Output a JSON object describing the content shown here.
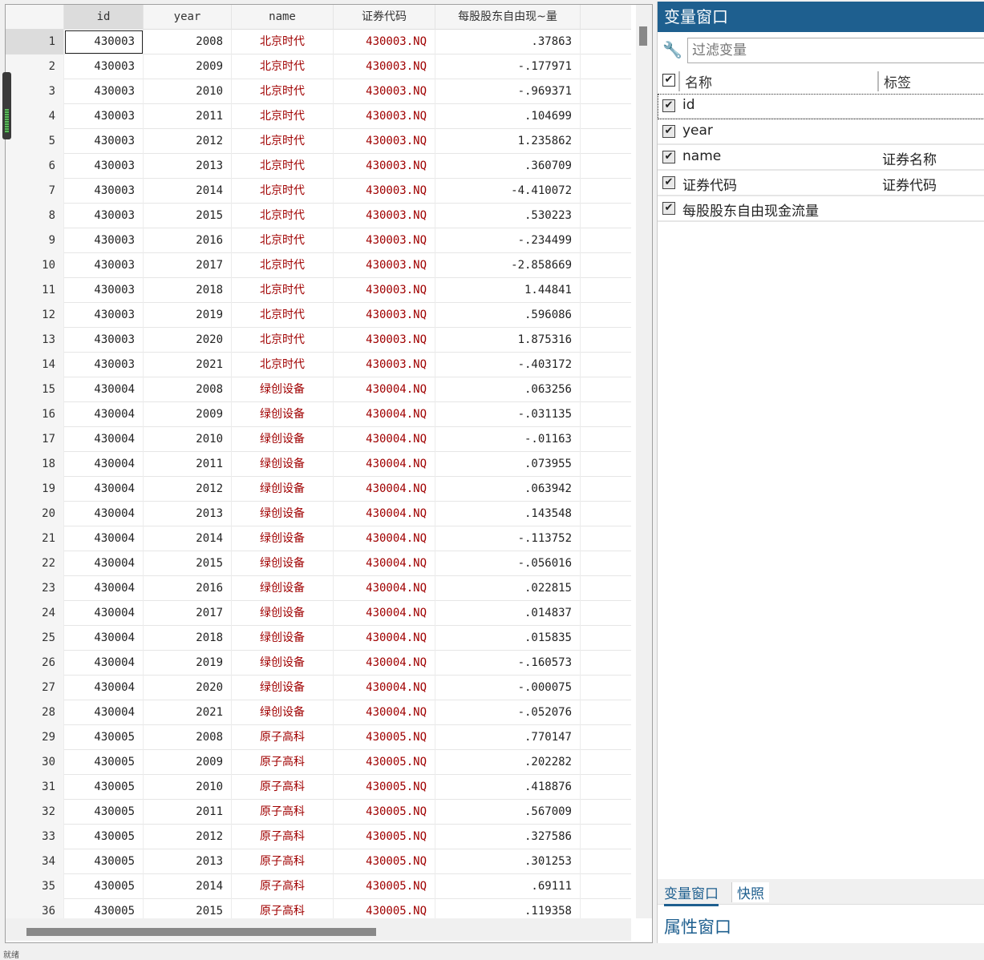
{
  "grid": {
    "headers": [
      "id",
      "year",
      "name",
      "证券代码",
      "每股股东自由现~量"
    ],
    "rows": [
      [
        "430003",
        "2008",
        "北京时代",
        "430003.NQ",
        ".37863"
      ],
      [
        "430003",
        "2009",
        "北京时代",
        "430003.NQ",
        "-.177971"
      ],
      [
        "430003",
        "2010",
        "北京时代",
        "430003.NQ",
        "-.969371"
      ],
      [
        "430003",
        "2011",
        "北京时代",
        "430003.NQ",
        ".104699"
      ],
      [
        "430003",
        "2012",
        "北京时代",
        "430003.NQ",
        "1.235862"
      ],
      [
        "430003",
        "2013",
        "北京时代",
        "430003.NQ",
        ".360709"
      ],
      [
        "430003",
        "2014",
        "北京时代",
        "430003.NQ",
        "-4.410072"
      ],
      [
        "430003",
        "2015",
        "北京时代",
        "430003.NQ",
        ".530223"
      ],
      [
        "430003",
        "2016",
        "北京时代",
        "430003.NQ",
        "-.234499"
      ],
      [
        "430003",
        "2017",
        "北京时代",
        "430003.NQ",
        "-2.858669"
      ],
      [
        "430003",
        "2018",
        "北京时代",
        "430003.NQ",
        "1.44841"
      ],
      [
        "430003",
        "2019",
        "北京时代",
        "430003.NQ",
        ".596086"
      ],
      [
        "430003",
        "2020",
        "北京时代",
        "430003.NQ",
        "1.875316"
      ],
      [
        "430003",
        "2021",
        "北京时代",
        "430003.NQ",
        "-.403172"
      ],
      [
        "430004",
        "2008",
        "绿创设备",
        "430004.NQ",
        ".063256"
      ],
      [
        "430004",
        "2009",
        "绿创设备",
        "430004.NQ",
        "-.031135"
      ],
      [
        "430004",
        "2010",
        "绿创设备",
        "430004.NQ",
        "-.01163"
      ],
      [
        "430004",
        "2011",
        "绿创设备",
        "430004.NQ",
        ".073955"
      ],
      [
        "430004",
        "2012",
        "绿创设备",
        "430004.NQ",
        ".063942"
      ],
      [
        "430004",
        "2013",
        "绿创设备",
        "430004.NQ",
        ".143548"
      ],
      [
        "430004",
        "2014",
        "绿创设备",
        "430004.NQ",
        "-.113752"
      ],
      [
        "430004",
        "2015",
        "绿创设备",
        "430004.NQ",
        "-.056016"
      ],
      [
        "430004",
        "2016",
        "绿创设备",
        "430004.NQ",
        ".022815"
      ],
      [
        "430004",
        "2017",
        "绿创设备",
        "430004.NQ",
        ".014837"
      ],
      [
        "430004",
        "2018",
        "绿创设备",
        "430004.NQ",
        ".015835"
      ],
      [
        "430004",
        "2019",
        "绿创设备",
        "430004.NQ",
        "-.160573"
      ],
      [
        "430004",
        "2020",
        "绿创设备",
        "430004.NQ",
        "-.000075"
      ],
      [
        "430004",
        "2021",
        "绿创设备",
        "430004.NQ",
        "-.052076"
      ],
      [
        "430005",
        "2008",
        "原子高科",
        "430005.NQ",
        ".770147"
      ],
      [
        "430005",
        "2009",
        "原子高科",
        "430005.NQ",
        ".202282"
      ],
      [
        "430005",
        "2010",
        "原子高科",
        "430005.NQ",
        ".418876"
      ],
      [
        "430005",
        "2011",
        "原子高科",
        "430005.NQ",
        ".567009"
      ],
      [
        "430005",
        "2012",
        "原子高科",
        "430005.NQ",
        ".327586"
      ],
      [
        "430005",
        "2013",
        "原子高科",
        "430005.NQ",
        ".301253"
      ],
      [
        "430005",
        "2014",
        "原子高科",
        "430005.NQ",
        ".69111"
      ],
      [
        "430005",
        "2015",
        "原子高科",
        "430005.NQ",
        ".119358"
      ]
    ]
  },
  "variables": {
    "title": "变量窗口",
    "filter_placeholder": "过滤变量",
    "col_name": "名称",
    "col_label": "标签",
    "items": [
      {
        "name": "id",
        "label": ""
      },
      {
        "name": "year",
        "label": ""
      },
      {
        "name": "name",
        "label": "证券名称"
      },
      {
        "name": "证券代码",
        "label": "证券代码"
      },
      {
        "name": "每股股东自由现金流量",
        "label": ""
      }
    ]
  },
  "tabs": [
    "变量窗口",
    "快照"
  ],
  "properties": {
    "title": "属性窗口"
  },
  "status": "就绪"
}
